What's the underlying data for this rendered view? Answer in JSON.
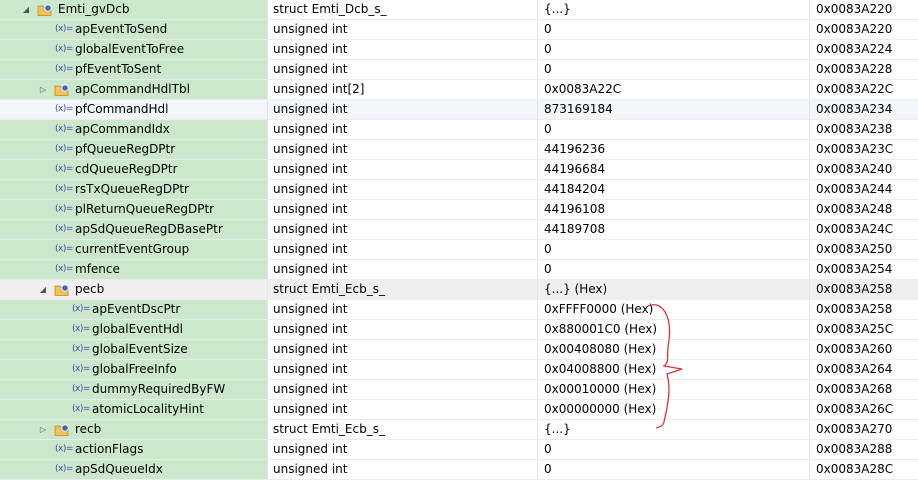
{
  "colors": {
    "name_column_bg": "#cbe8cc",
    "selected_row_bg": "#f2f5fa",
    "group_row_bg": "#efefef",
    "annotation": "#d23a3a"
  },
  "icons": {
    "variable": "variable-icon",
    "struct": "struct-icon",
    "expanded": "expanded-triangle-icon",
    "collapsed": "collapsed-triangle-icon"
  },
  "rows": [
    {
      "name": "Emti_gvDcb",
      "type": "struct Emti_Dcb_s_",
      "value": "{...}",
      "address": "0x0083A220",
      "depth": 0,
      "kind": "struct",
      "state": "expanded",
      "style": ""
    },
    {
      "name": "apEventToSend",
      "type": "unsigned int",
      "value": "0",
      "address": "0x0083A220",
      "depth": 1,
      "kind": "var",
      "state": "",
      "style": ""
    },
    {
      "name": "globalEventToFree",
      "type": "unsigned int",
      "value": "0",
      "address": "0x0083A224",
      "depth": 1,
      "kind": "var",
      "state": "",
      "style": ""
    },
    {
      "name": "pfEventToSent",
      "type": "unsigned int",
      "value": "0",
      "address": "0x0083A228",
      "depth": 1,
      "kind": "var",
      "state": "",
      "style": ""
    },
    {
      "name": "apCommandHdlTbl",
      "type": "unsigned int[2]",
      "value": "0x0083A22C",
      "address": "0x0083A22C",
      "depth": 1,
      "kind": "struct",
      "state": "collapsed",
      "style": ""
    },
    {
      "name": "pfCommandHdl",
      "type": "unsigned int",
      "value": "873169184",
      "address": "0x0083A234",
      "depth": 1,
      "kind": "var",
      "state": "",
      "style": "selected"
    },
    {
      "name": "apCommandIdx",
      "type": "unsigned int",
      "value": "0",
      "address": "0x0083A238",
      "depth": 1,
      "kind": "var",
      "state": "",
      "style": ""
    },
    {
      "name": "pfQueueRegDPtr",
      "type": "unsigned int",
      "value": "44196236",
      "address": "0x0083A23C",
      "depth": 1,
      "kind": "var",
      "state": "",
      "style": ""
    },
    {
      "name": "cdQueueRegDPtr",
      "type": "unsigned int",
      "value": "44196684",
      "address": "0x0083A240",
      "depth": 1,
      "kind": "var",
      "state": "",
      "style": ""
    },
    {
      "name": "rsTxQueueRegDPtr",
      "type": "unsigned int",
      "value": "44184204",
      "address": "0x0083A244",
      "depth": 1,
      "kind": "var",
      "state": "",
      "style": ""
    },
    {
      "name": "plReturnQueueRegDPtr",
      "type": "unsigned int",
      "value": "44196108",
      "address": "0x0083A248",
      "depth": 1,
      "kind": "var",
      "state": "",
      "style": ""
    },
    {
      "name": "apSdQueueRegDBasePtr",
      "type": "unsigned int",
      "value": "44189708",
      "address": "0x0083A24C",
      "depth": 1,
      "kind": "var",
      "state": "",
      "style": ""
    },
    {
      "name": "currentEventGroup",
      "type": "unsigned int",
      "value": "0",
      "address": "0x0083A250",
      "depth": 1,
      "kind": "var",
      "state": "",
      "style": ""
    },
    {
      "name": "mfence",
      "type": "unsigned int",
      "value": "0",
      "address": "0x0083A254",
      "depth": 1,
      "kind": "var",
      "state": "",
      "style": ""
    },
    {
      "name": "pecb",
      "type": "struct Emti_Ecb_s_",
      "value": "{...} (Hex)",
      "address": "0x0083A258",
      "depth": 1,
      "kind": "struct",
      "state": "expanded",
      "style": "gray"
    },
    {
      "name": "apEventDscPtr",
      "type": "unsigned int",
      "value": "0xFFFF0000 (Hex)",
      "address": "0x0083A258",
      "depth": 2,
      "kind": "var",
      "state": "",
      "style": ""
    },
    {
      "name": "globalEventHdl",
      "type": "unsigned int",
      "value": "0x880001C0 (Hex)",
      "address": "0x0083A25C",
      "depth": 2,
      "kind": "var",
      "state": "",
      "style": ""
    },
    {
      "name": "globalEventSize",
      "type": "unsigned int",
      "value": "0x00408080 (Hex)",
      "address": "0x0083A260",
      "depth": 2,
      "kind": "var",
      "state": "",
      "style": ""
    },
    {
      "name": "globalFreeInfo",
      "type": "unsigned int",
      "value": "0x04008800 (Hex)",
      "address": "0x0083A264",
      "depth": 2,
      "kind": "var",
      "state": "",
      "style": ""
    },
    {
      "name": "dummyRequiredByFW",
      "type": "unsigned int",
      "value": "0x00010000 (Hex)",
      "address": "0x0083A268",
      "depth": 2,
      "kind": "var",
      "state": "",
      "style": ""
    },
    {
      "name": "atomicLocalityHint",
      "type": "unsigned int",
      "value": "0x00000000 (Hex)",
      "address": "0x0083A26C",
      "depth": 2,
      "kind": "var",
      "state": "",
      "style": ""
    },
    {
      "name": "recb",
      "type": "struct Emti_Ecb_s_",
      "value": "{...}",
      "address": "0x0083A270",
      "depth": 1,
      "kind": "struct",
      "state": "collapsed",
      "style": ""
    },
    {
      "name": "actionFlags",
      "type": "unsigned int",
      "value": "0",
      "address": "0x0083A288",
      "depth": 1,
      "kind": "var",
      "state": "",
      "style": ""
    },
    {
      "name": "apSdQueueIdx",
      "type": "unsigned int",
      "value": "0",
      "address": "0x0083A28C",
      "depth": 1,
      "kind": "var",
      "state": "",
      "style": ""
    }
  ]
}
